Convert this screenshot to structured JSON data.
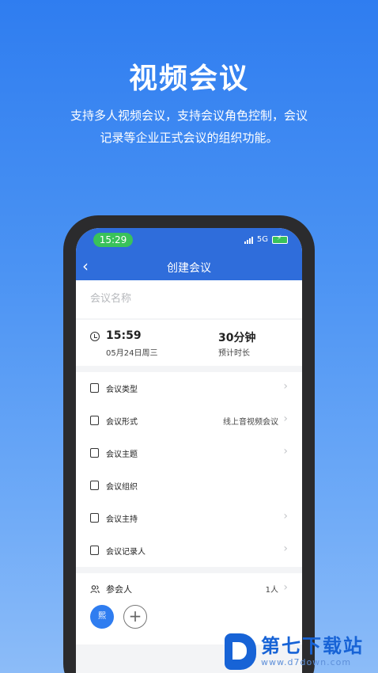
{
  "hero": {
    "title": "视频会议",
    "desc_line1": "支持多人视频会议，支持会议角色控制，会议",
    "desc_line2": "记录等企业正式会议的组织功能。"
  },
  "status": {
    "time": "15:29",
    "network": "5G"
  },
  "nav": {
    "back": "‹",
    "title": "创建会议"
  },
  "form": {
    "name_placeholder": "会议名称",
    "start_time": "15:59",
    "start_date": "05月24日周三",
    "duration": "30分钟",
    "duration_label": "预计时长",
    "items": [
      {
        "label": "会议类型",
        "value": ""
      },
      {
        "label": "会议形式",
        "value": "线上音视频会议"
      },
      {
        "label": "会议主题",
        "value": ""
      },
      {
        "label": "会议组织",
        "value": ""
      },
      {
        "label": "会议主持",
        "value": ""
      },
      {
        "label": "会议记录人",
        "value": ""
      }
    ],
    "participants_label": "参会人",
    "participants_count": "1人",
    "avatar_text": "熙",
    "add_symbol": "+"
  },
  "watermark": {
    "main": "第七下载站",
    "sub": "www.d7down.com"
  },
  "colors": {
    "accent": "#2f6ddb",
    "status_green": "#39c25a",
    "watermark_blue": "#1763d6"
  }
}
